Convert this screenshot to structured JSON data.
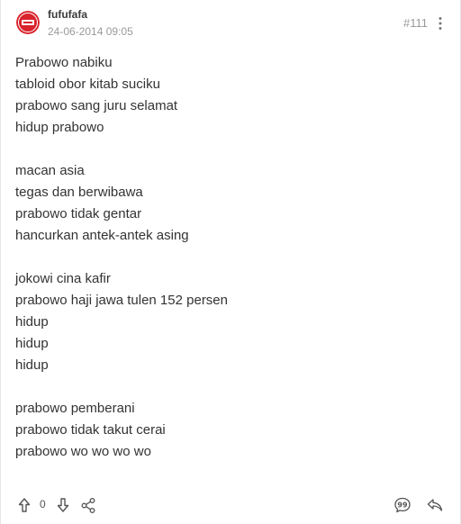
{
  "post": {
    "username": "fufufafa",
    "timestamp": "24-06-2014 09:05",
    "post_number": "#111",
    "lines": [
      "Prabowo nabiku",
      "tabloid obor kitab suciku",
      "prabowo sang juru selamat",
      "hidup prabowo",
      "",
      "macan asia",
      "tegas dan berwibawa",
      "prabowo tidak gentar",
      "hancurkan antek-antek asing",
      "",
      "jokowi cina kafir",
      "prabowo haji jawa tulen 152 persen",
      "hidup",
      "hidup",
      "hidup",
      "",
      "prabowo pemberani",
      "prabowo tidak takut cerai",
      "prabowo wo wo wo wo"
    ],
    "vote_count": "0"
  },
  "icons": {
    "avatar": "avatar-badge-icon",
    "more": "vertical-ellipsis-icon",
    "upvote": "arrow-up-icon",
    "downvote": "arrow-down-icon",
    "share": "share-icon",
    "quote": "quote-bubble-icon",
    "reply": "reply-arrow-icon"
  },
  "colors": {
    "avatar_red": "#d9232d",
    "text": "#333333",
    "muted": "#9a9a9a",
    "icon": "#555555"
  }
}
